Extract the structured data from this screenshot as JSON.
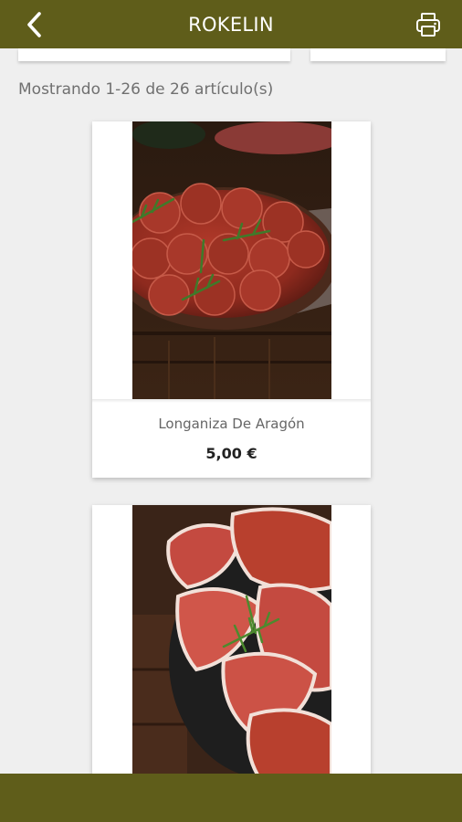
{
  "app_bar": {
    "title": "ROKELIN",
    "back_icon": "chevron-left-icon",
    "print_icon": "printer-icon",
    "color": "#5f5d1a"
  },
  "results": {
    "count_text": "Mostrando 1-26 de 26 artículo(s)"
  },
  "products": [
    {
      "name": "Longaniza De Aragón",
      "price": "5,00 €",
      "image": "sliced-longaniza-plate"
    },
    {
      "name": "",
      "price": "",
      "image": "sliced-jamon-plate"
    }
  ]
}
